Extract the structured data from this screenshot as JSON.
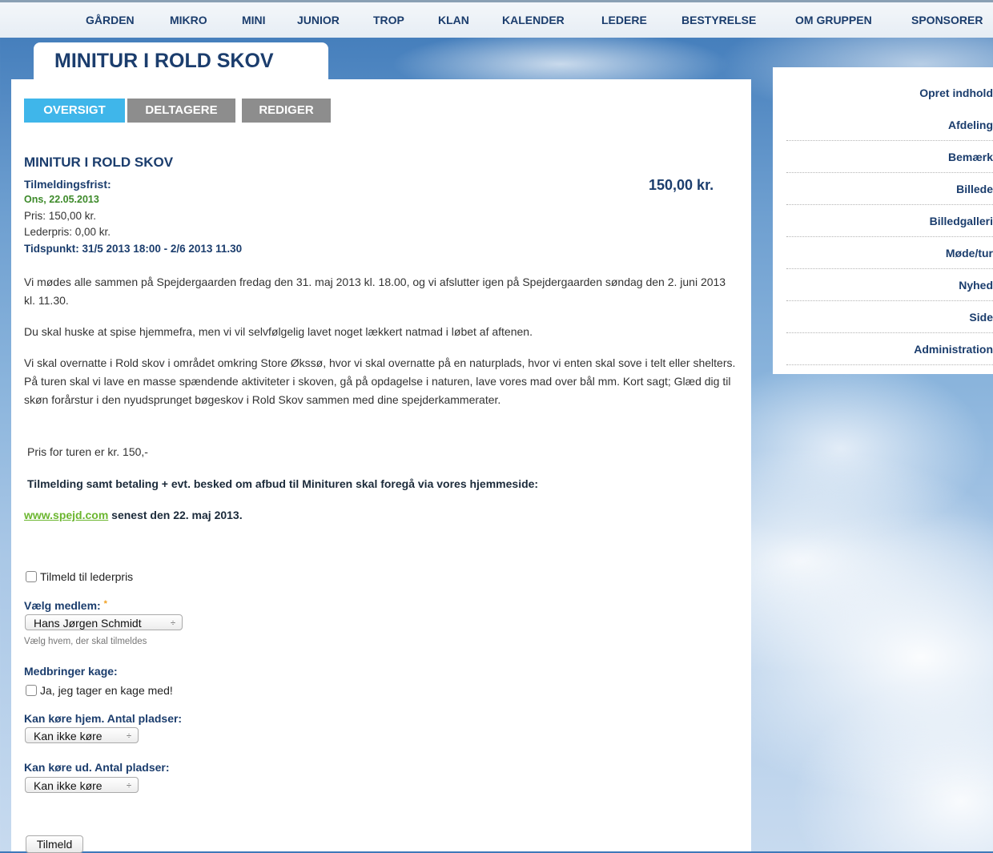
{
  "nav": [
    "GÅRDEN",
    "MIKRO",
    "MINI",
    "JUNIOR",
    "TROP",
    "KLAN",
    "KALENDER",
    "LEDERE",
    "BESTYRELSE",
    "OM GRUPPEN",
    "SPONSORER"
  ],
  "page_title": "MINITUR I ROLD SKOV",
  "tabs": {
    "overview": "OVERSIGT",
    "participants": "DELTAGERE",
    "edit": "REDIGER"
  },
  "event": {
    "title": "MINITUR I ROLD SKOV",
    "deadline_label": "Tilmeldingsfrist:",
    "deadline_date": "Ons, 22.05.2013",
    "price": "Pris: 150,00 kr.",
    "leader_price": "Lederpris: 0,00 kr.",
    "time": "Tidspunkt: 31/5 2013 18:00 - 2/6 2013 11.30",
    "price_big": "150,00 kr."
  },
  "body": {
    "p1": "Vi mødes alle sammen på Spejdergaarden fredag den 31. maj 2013 kl. 18.00, og vi afslutter igen på Spejdergaarden søndag den 2. juni 2013 kl. 11.30.",
    "p2": "Du skal huske at spise hjemmefra, men vi vil selvfølgelig lavet noget lækkert natmad i løbet af aftenen.",
    "p3": "Vi skal overnatte i Rold skov i området omkring Store Økssø, hvor vi skal overnatte på en naturplads, hvor vi enten skal sove i telt eller shelters. På turen skal vi lave en masse spændende aktiviteter i skoven, gå på opdagelse i naturen, lave vores mad over bål mm. Kort sagt; Glæd dig til skøn forårstur i den nyudsprunget bøgeskov i Rold Skov sammen med dine spejderkammerater.",
    "p4": "Pris for turen er kr. 150,-",
    "p5": "Tilmelding samt betaling + evt. besked om afbud til Minituren skal foregå via vores hjemmeside:",
    "link": "www.spejd.com",
    "p6_suffix": " senest den 22. maj 2013."
  },
  "form": {
    "leader_price_checkbox": "Tilmeld til lederpris",
    "member_label": "Vælg medlem:",
    "required_mark": "*",
    "member_value": "Hans Jørgen Schmidt",
    "member_desc": "Vælg hvem, der skal tilmeldes",
    "cake_label": "Medbringer kage:",
    "cake_checkbox": "Ja, jeg tager en kage med!",
    "drive_home_label": "Kan køre hjem. Antal pladser:",
    "drive_home_value": "Kan ikke køre",
    "drive_out_label": "Kan køre ud. Antal pladser:",
    "drive_out_value": "Kan ikke køre",
    "submit": "Tilmeld",
    "select_arrow": "÷"
  },
  "sidebar": [
    "Opret indhold",
    "Afdeling",
    "Bemærk",
    "Billede",
    "Billedgalleri",
    "Møde/tur",
    "Nyhed",
    "Side",
    "Administration"
  ]
}
